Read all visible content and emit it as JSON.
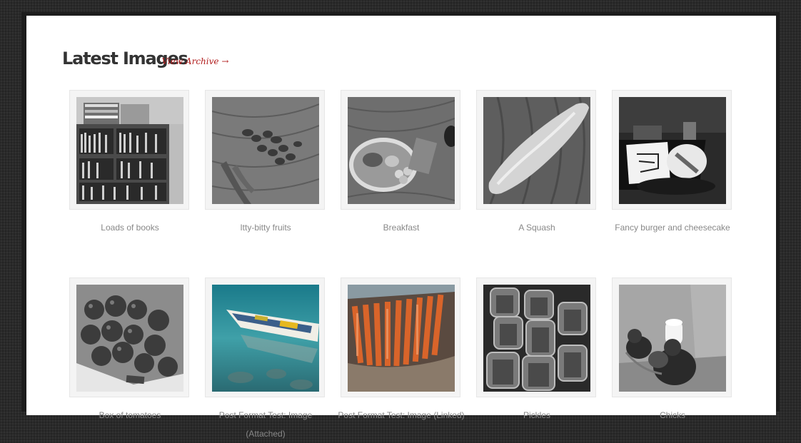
{
  "section": {
    "title": "Latest Images",
    "archive_link": "View Archive →"
  },
  "images": [
    {
      "caption": "Loads of books",
      "icon": "bookshelf-photo"
    },
    {
      "caption": "Itty-bitty fruits",
      "icon": "fruits-photo"
    },
    {
      "caption": "Breakfast",
      "icon": "breakfast-plate-photo"
    },
    {
      "caption": "A Squash",
      "icon": "squash-photo"
    },
    {
      "caption": "Fancy burger and cheesecake",
      "icon": "burger-cheesecake-photo"
    },
    {
      "caption": "Box of tomatoes",
      "icon": "tomato-box-photo"
    },
    {
      "caption": "Post Format Test: Image (Attached)",
      "icon": "boat-on-water-photo"
    },
    {
      "caption": "Post Format Test: Image (Linked)",
      "icon": "grilled-carrots-photo"
    },
    {
      "caption": "Pickles",
      "icon": "pickle-jars-photo"
    },
    {
      "caption": "Chicks",
      "icon": "chicks-photo"
    }
  ],
  "colors": {
    "link": "#b11d1d",
    "caption": "#888888",
    "heading": "#333333"
  }
}
